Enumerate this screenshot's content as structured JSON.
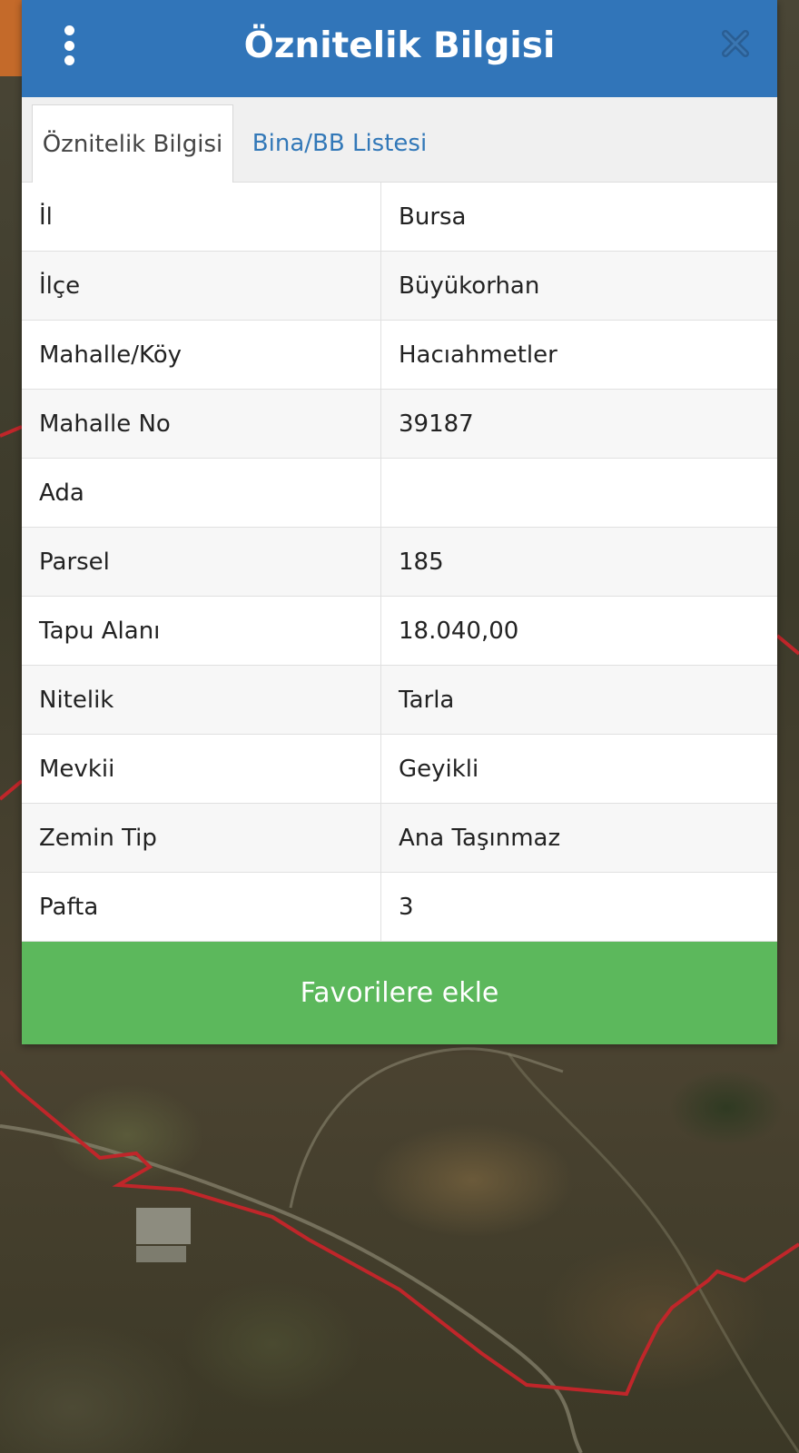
{
  "header": {
    "title": "Öznitelik Bilgisi",
    "menu_icon": "more-vertical-icon",
    "close_icon": "close-icon"
  },
  "tabs": [
    {
      "label": "Öznitelik Bilgisi",
      "active": true
    },
    {
      "label": "Bina/BB Listesi",
      "active": false
    }
  ],
  "attributes": [
    {
      "key": "İl",
      "value": "Bursa"
    },
    {
      "key": "İlçe",
      "value": "Büyükorhan"
    },
    {
      "key": "Mahalle/Köy",
      "value": "Hacıahmetler"
    },
    {
      "key": "Mahalle No",
      "value": "39187"
    },
    {
      "key": "Ada",
      "value": ""
    },
    {
      "key": "Parsel",
      "value": "185"
    },
    {
      "key": "Tapu Alanı",
      "value": "18.040,00"
    },
    {
      "key": "Nitelik",
      "value": "Tarla"
    },
    {
      "key": "Mevkii",
      "value": "Geyikli"
    },
    {
      "key": "Zemin Tip",
      "value": "Ana Taşınmaz"
    },
    {
      "key": "Pafta",
      "value": "3"
    }
  ],
  "favorite_button": {
    "label": "Favorilere ekle"
  },
  "colors": {
    "header": "#3175b9",
    "tab_link": "#3278b8",
    "favorite_button": "#5cb85c",
    "parcel_border": "#c0262a"
  }
}
